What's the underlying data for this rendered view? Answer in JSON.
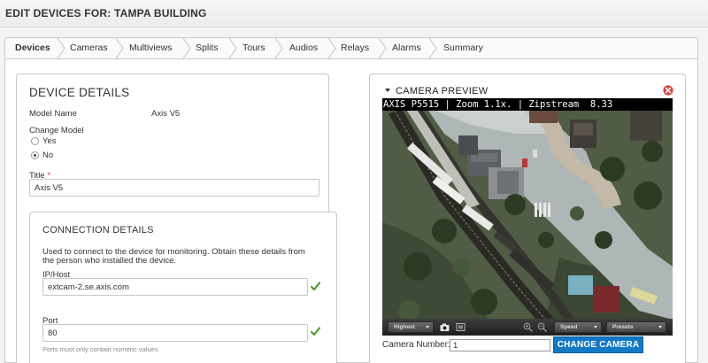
{
  "page": {
    "title": "EDIT DEVICES FOR: TAMPA BUILDING"
  },
  "tabs": [
    {
      "label": "Devices",
      "active": true
    },
    {
      "label": "Cameras"
    },
    {
      "label": "Multiviews"
    },
    {
      "label": "Splits"
    },
    {
      "label": "Tours"
    },
    {
      "label": "Audios"
    },
    {
      "label": "Relays"
    },
    {
      "label": "Alarms"
    },
    {
      "label": "Summary"
    }
  ],
  "device_details": {
    "heading": "DEVICE DETAILS",
    "model_name_label": "Model Name",
    "model_name_value": "Axis V5",
    "change_model_label": "Change Model",
    "change_model_options": [
      {
        "label": "Yes",
        "selected": false
      },
      {
        "label": "No",
        "selected": true
      }
    ],
    "title_label": "Title",
    "title_required": "*",
    "title_value": "Axis V5"
  },
  "connection": {
    "heading": "CONNECTION DETAILS",
    "description": "Used to connect to the device for monitoring. Obtain these details from the person who installed the device.",
    "host_label": "IP/Host",
    "host_value": "extcam-2.se.axis.com",
    "port_label": "Port",
    "port_value": "80",
    "port_hint": "Ports must only contain numeric values."
  },
  "preview": {
    "heading": "CAMERA PREVIEW",
    "overlay_text": "AXIS P5515 | Zoom 1.1x. | Zipstream  8.33",
    "quality_label": "Highest",
    "speed_label": "Speed",
    "presets_label": "Presets",
    "camera_number_label": "Camera Number:",
    "camera_number_value": "1",
    "change_button": "CHANGE CAMERA"
  },
  "colors": {
    "accent": "#1479c5",
    "valid_check": "#4a9a2c",
    "close": "#d9473f"
  },
  "icons": [
    "caret-down-icon",
    "close-icon",
    "check-icon",
    "snapshot-icon",
    "zoom-in-icon",
    "zoom-out-icon"
  ]
}
